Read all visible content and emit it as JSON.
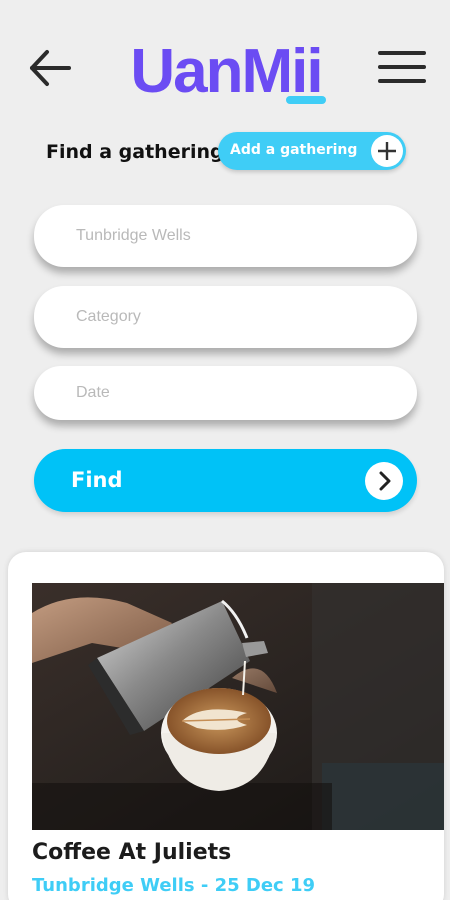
{
  "header": {
    "back_icon": "arrow-left-icon",
    "menu_icon": "hamburger-menu-icon",
    "logo_text": "UanMii",
    "logo_color": "#6b4cf3",
    "logo_accent_color": "#3fcdf6"
  },
  "section": {
    "title": "Find a gathering",
    "add_button_label": "Add a gathering",
    "add_icon": "plus-icon"
  },
  "search": {
    "location_placeholder": "Tunbridge Wells",
    "category_placeholder": "Category",
    "date_placeholder": "Date",
    "find_label": "Find",
    "find_icon": "chevron-right-icon"
  },
  "colors": {
    "accent": "#00c2f7",
    "background": "#eeeeee",
    "subtitle": "#3fcdf6"
  },
  "gatherings": [
    {
      "title": "Coffee At Juliets",
      "subtitle": "Tunbridge Wells - 25 Dec 19",
      "image": "latte-art-photo"
    }
  ]
}
